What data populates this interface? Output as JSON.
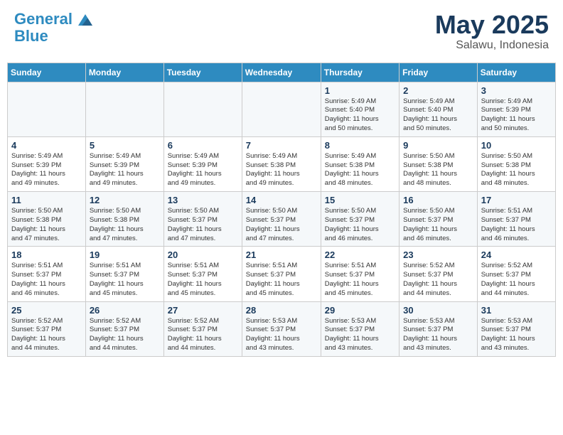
{
  "header": {
    "logo_line1": "General",
    "logo_line2": "Blue",
    "month_year": "May 2025",
    "location": "Salawu, Indonesia"
  },
  "days_of_week": [
    "Sunday",
    "Monday",
    "Tuesday",
    "Wednesday",
    "Thursday",
    "Friday",
    "Saturday"
  ],
  "weeks": [
    [
      {
        "day": "",
        "info": ""
      },
      {
        "day": "",
        "info": ""
      },
      {
        "day": "",
        "info": ""
      },
      {
        "day": "",
        "info": ""
      },
      {
        "day": "1",
        "info": "Sunrise: 5:49 AM\nSunset: 5:40 PM\nDaylight: 11 hours\nand 50 minutes."
      },
      {
        "day": "2",
        "info": "Sunrise: 5:49 AM\nSunset: 5:40 PM\nDaylight: 11 hours\nand 50 minutes."
      },
      {
        "day": "3",
        "info": "Sunrise: 5:49 AM\nSunset: 5:39 PM\nDaylight: 11 hours\nand 50 minutes."
      }
    ],
    [
      {
        "day": "4",
        "info": "Sunrise: 5:49 AM\nSunset: 5:39 PM\nDaylight: 11 hours\nand 49 minutes."
      },
      {
        "day": "5",
        "info": "Sunrise: 5:49 AM\nSunset: 5:39 PM\nDaylight: 11 hours\nand 49 minutes."
      },
      {
        "day": "6",
        "info": "Sunrise: 5:49 AM\nSunset: 5:39 PM\nDaylight: 11 hours\nand 49 minutes."
      },
      {
        "day": "7",
        "info": "Sunrise: 5:49 AM\nSunset: 5:38 PM\nDaylight: 11 hours\nand 49 minutes."
      },
      {
        "day": "8",
        "info": "Sunrise: 5:49 AM\nSunset: 5:38 PM\nDaylight: 11 hours\nand 48 minutes."
      },
      {
        "day": "9",
        "info": "Sunrise: 5:50 AM\nSunset: 5:38 PM\nDaylight: 11 hours\nand 48 minutes."
      },
      {
        "day": "10",
        "info": "Sunrise: 5:50 AM\nSunset: 5:38 PM\nDaylight: 11 hours\nand 48 minutes."
      }
    ],
    [
      {
        "day": "11",
        "info": "Sunrise: 5:50 AM\nSunset: 5:38 PM\nDaylight: 11 hours\nand 47 minutes."
      },
      {
        "day": "12",
        "info": "Sunrise: 5:50 AM\nSunset: 5:38 PM\nDaylight: 11 hours\nand 47 minutes."
      },
      {
        "day": "13",
        "info": "Sunrise: 5:50 AM\nSunset: 5:37 PM\nDaylight: 11 hours\nand 47 minutes."
      },
      {
        "day": "14",
        "info": "Sunrise: 5:50 AM\nSunset: 5:37 PM\nDaylight: 11 hours\nand 47 minutes."
      },
      {
        "day": "15",
        "info": "Sunrise: 5:50 AM\nSunset: 5:37 PM\nDaylight: 11 hours\nand 46 minutes."
      },
      {
        "day": "16",
        "info": "Sunrise: 5:50 AM\nSunset: 5:37 PM\nDaylight: 11 hours\nand 46 minutes."
      },
      {
        "day": "17",
        "info": "Sunrise: 5:51 AM\nSunset: 5:37 PM\nDaylight: 11 hours\nand 46 minutes."
      }
    ],
    [
      {
        "day": "18",
        "info": "Sunrise: 5:51 AM\nSunset: 5:37 PM\nDaylight: 11 hours\nand 46 minutes."
      },
      {
        "day": "19",
        "info": "Sunrise: 5:51 AM\nSunset: 5:37 PM\nDaylight: 11 hours\nand 45 minutes."
      },
      {
        "day": "20",
        "info": "Sunrise: 5:51 AM\nSunset: 5:37 PM\nDaylight: 11 hours\nand 45 minutes."
      },
      {
        "day": "21",
        "info": "Sunrise: 5:51 AM\nSunset: 5:37 PM\nDaylight: 11 hours\nand 45 minutes."
      },
      {
        "day": "22",
        "info": "Sunrise: 5:51 AM\nSunset: 5:37 PM\nDaylight: 11 hours\nand 45 minutes."
      },
      {
        "day": "23",
        "info": "Sunrise: 5:52 AM\nSunset: 5:37 PM\nDaylight: 11 hours\nand 44 minutes."
      },
      {
        "day": "24",
        "info": "Sunrise: 5:52 AM\nSunset: 5:37 PM\nDaylight: 11 hours\nand 44 minutes."
      }
    ],
    [
      {
        "day": "25",
        "info": "Sunrise: 5:52 AM\nSunset: 5:37 PM\nDaylight: 11 hours\nand 44 minutes."
      },
      {
        "day": "26",
        "info": "Sunrise: 5:52 AM\nSunset: 5:37 PM\nDaylight: 11 hours\nand 44 minutes."
      },
      {
        "day": "27",
        "info": "Sunrise: 5:52 AM\nSunset: 5:37 PM\nDaylight: 11 hours\nand 44 minutes."
      },
      {
        "day": "28",
        "info": "Sunrise: 5:53 AM\nSunset: 5:37 PM\nDaylight: 11 hours\nand 43 minutes."
      },
      {
        "day": "29",
        "info": "Sunrise: 5:53 AM\nSunset: 5:37 PM\nDaylight: 11 hours\nand 43 minutes."
      },
      {
        "day": "30",
        "info": "Sunrise: 5:53 AM\nSunset: 5:37 PM\nDaylight: 11 hours\nand 43 minutes."
      },
      {
        "day": "31",
        "info": "Sunrise: 5:53 AM\nSunset: 5:37 PM\nDaylight: 11 hours\nand 43 minutes."
      }
    ]
  ]
}
